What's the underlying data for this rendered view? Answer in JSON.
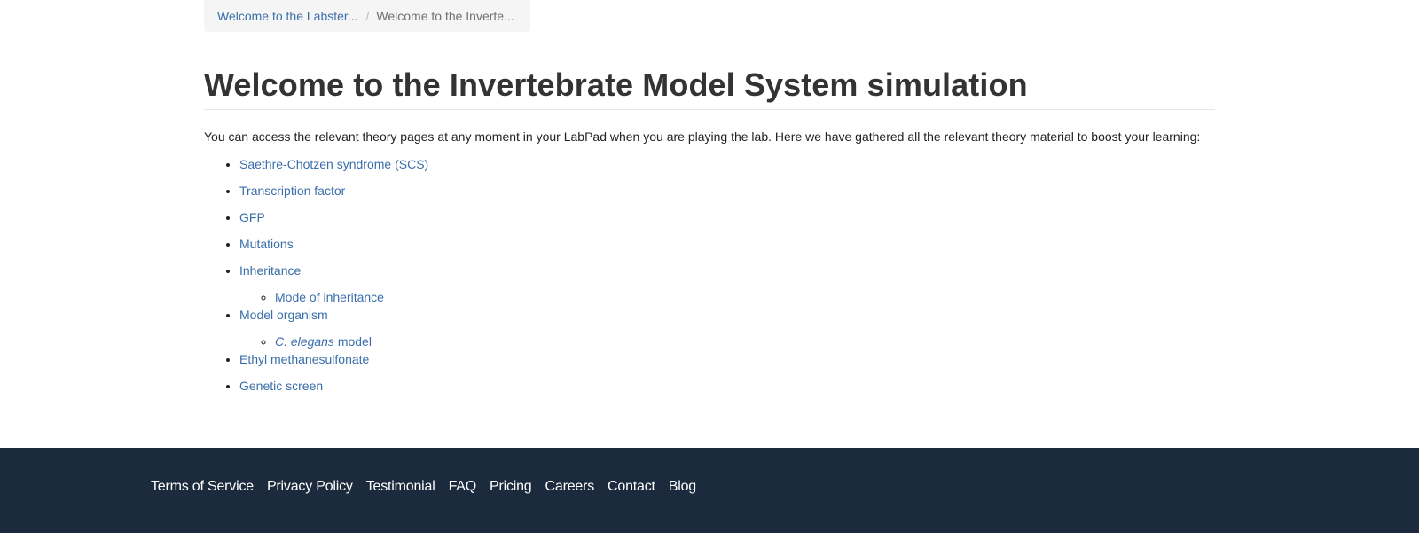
{
  "breadcrumb": {
    "parent": "Welcome to the Labster...",
    "separator": "/",
    "current": "Welcome to the Inverte..."
  },
  "page": {
    "title": "Welcome to the Invertebrate Model System simulation",
    "intro": "You can access the relevant theory pages at any moment in your LabPad when you are playing the lab. Here we have gathered all the relevant theory material to boost your learning:"
  },
  "topics": [
    {
      "label": "Saethre-Chotzen syndrome (SCS)"
    },
    {
      "label": "Transcription factor"
    },
    {
      "label": "GFP"
    },
    {
      "label": "Mutations"
    },
    {
      "label": "Inheritance",
      "sub": [
        {
          "label": "Mode of inheritance"
        }
      ]
    },
    {
      "label": "Model organism",
      "sub": [
        {
          "label_italic": "C. elegans",
          "label_rest": " model"
        }
      ]
    },
    {
      "label": "Ethyl methanesulfonate"
    },
    {
      "label": "Genetic screen"
    }
  ],
  "footer": {
    "links": [
      "Terms of Service",
      "Privacy Policy",
      "Testimonial",
      "FAQ",
      "Pricing",
      "Careers",
      "Contact",
      "Blog"
    ],
    "background": "#1b2a3c"
  },
  "colors": {
    "link": "#3a6eaa",
    "text": "#222222",
    "breadcrumb_bg": "#f5f5f5"
  }
}
